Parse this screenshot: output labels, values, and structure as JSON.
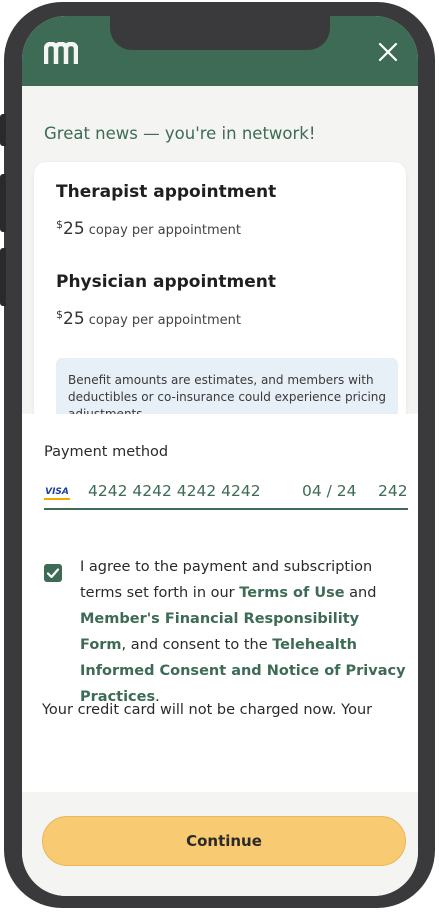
{
  "header": {
    "logo_icon": "brand-logo-icon",
    "close_icon": "close-icon",
    "bg_color": "#3d6b55"
  },
  "network": {
    "message": "Great news — you're in network!"
  },
  "benefits": {
    "items": [
      {
        "title": "Therapist appointment",
        "currency": "$",
        "amount": "25",
        "suffix": " copay per appointment"
      },
      {
        "title": "Physician appointment",
        "currency": "$",
        "amount": "25",
        "suffix": " copay per appointment"
      }
    ],
    "notice": "Benefit amounts are estimates, and members with deductibles or co-insurance could experience pricing adjustments."
  },
  "payment": {
    "label": "Payment method",
    "card_brand": "VISA",
    "card_number": "4242 4242 4242 4242",
    "expiry": "04 / 24",
    "cvc": "242"
  },
  "agreement": {
    "checked": true,
    "text_1": "I agree to the payment and subscription terms set forth in our ",
    "link_terms": "Terms of Use",
    "text_2": " and ",
    "link_financial": "Member's Financial Responsibility Form",
    "text_3": ", and consent to the ",
    "link_telehealth": "Telehealth Informed Consent and Notice of Privacy Practices",
    "text_4": "."
  },
  "charge_note": "Your credit card will not be charged now. Your",
  "footer": {
    "continue_label": "Continue",
    "button_color": "#f8ca72"
  }
}
